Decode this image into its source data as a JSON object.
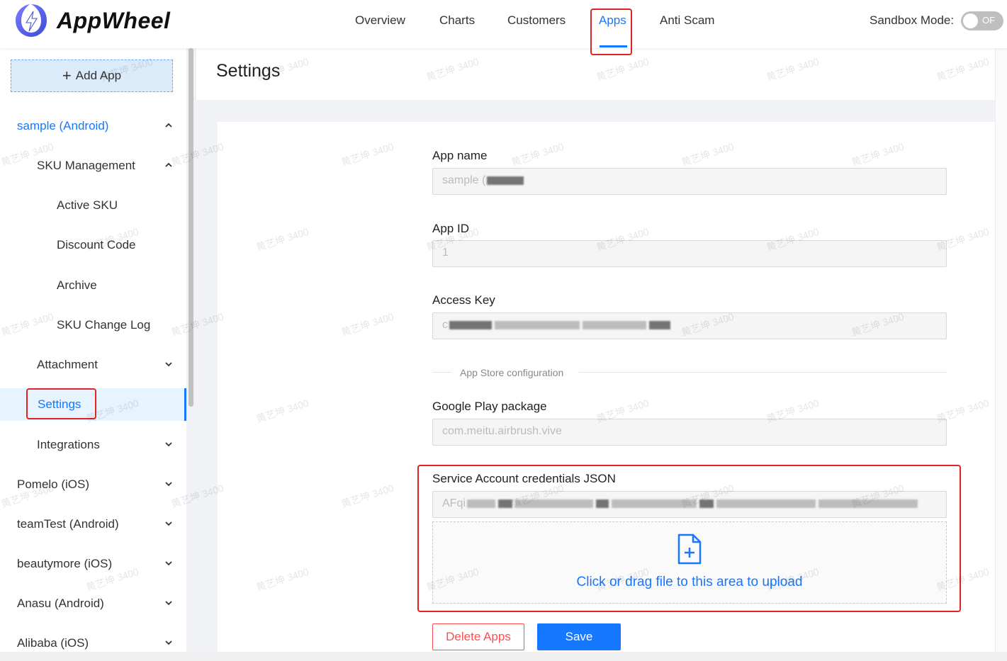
{
  "header": {
    "brand": "AppWheel",
    "nav": [
      "Overview",
      "Charts",
      "Customers",
      "Apps",
      "Anti Scam"
    ],
    "active_nav": "Apps",
    "sandbox_label": "Sandbox Mode:",
    "sandbox_toggle_text": "OF"
  },
  "sidebar": {
    "add_app": "Add App",
    "current_app": "sample (Android)",
    "sku_management": "SKU Management",
    "active_sku": "Active SKU",
    "discount_code": "Discount Code",
    "archive": "Archive",
    "sku_change_log": "SKU Change Log",
    "attachment": "Attachment",
    "settings": "Settings",
    "integrations": "Integrations",
    "apps": [
      "Pomelo (iOS)",
      "teamTest (Android)",
      "beautymore (iOS)",
      "Anasu (Android)",
      "Alibaba (iOS)"
    ]
  },
  "main": {
    "title": "Settings",
    "app_name_label": "App name",
    "app_name_value": "sample (",
    "app_id_label": "App ID",
    "app_id_value": "1",
    "access_key_label": "Access Key",
    "access_key_value": "c",
    "section_divider": "App Store configuration",
    "gp_package_label": "Google Play package",
    "gp_package_value": "com.meitu.airbrush.vive",
    "service_account_label": "Service Account credentials JSON",
    "service_account_value": "AFqi",
    "upload_text": "Click or drag file to this area to upload",
    "delete_button": "Delete Apps",
    "save_button": "Save"
  },
  "watermark_text": "黄艺坤 3400",
  "colors": {
    "primary": "#1677ff",
    "danger": "#ff4d4f",
    "highlight": "#e02424"
  }
}
